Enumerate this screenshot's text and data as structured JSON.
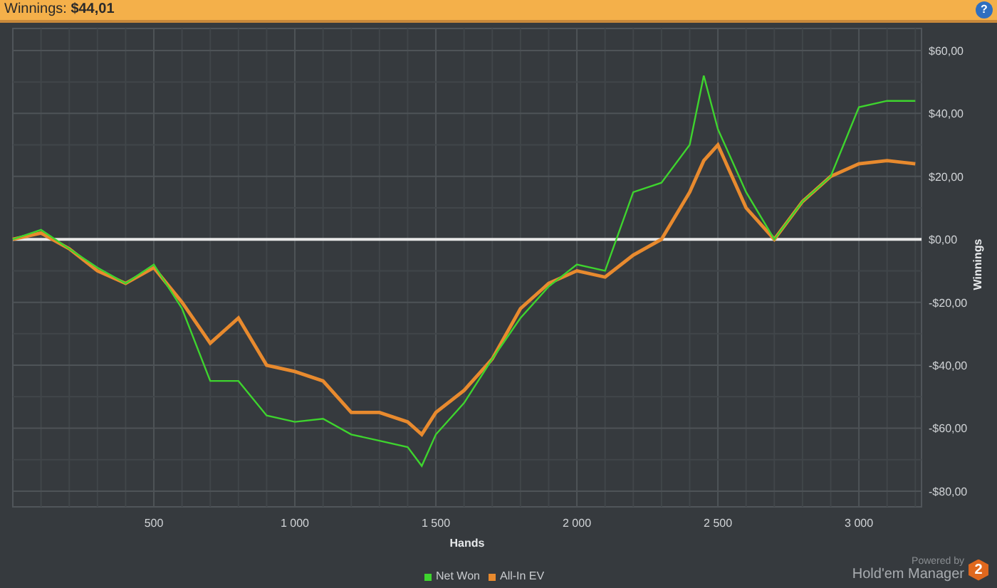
{
  "header": {
    "text": "Winnings: **$44,01**",
    "help": "?"
  },
  "chart": {
    "chart_data": {
      "type": "line",
      "xlabel": "Hands",
      "ylabel": "Winnings",
      "x": [
        0,
        100,
        200,
        300,
        400,
        500,
        600,
        700,
        800,
        900,
        1000,
        1100,
        1200,
        1300,
        1400,
        1450,
        1500,
        1600,
        1700,
        1800,
        1900,
        2000,
        2100,
        2200,
        2300,
        2400,
        2450,
        2500,
        2600,
        2700,
        2800,
        2900,
        3000,
        3100,
        3200
      ],
      "series": [
        {
          "name": "Net Won",
          "color": "#3ed42e",
          "values": [
            0,
            3,
            -3,
            -9,
            -14,
            -8,
            -22,
            -45,
            -45,
            -56,
            -58,
            -57,
            -62,
            -64,
            -66,
            -72,
            -62,
            -52,
            -38,
            -25,
            -15,
            -8,
            -10,
            15,
            18,
            30,
            52,
            35,
            15,
            0,
            12,
            20,
            42,
            44,
            44
          ]
        },
        {
          "name": "All-In EV",
          "color": "#e88a2e",
          "values": [
            0,
            2,
            -3,
            -10,
            -14,
            -9,
            -20,
            -33,
            -25,
            -40,
            -42,
            -45,
            -55,
            -55,
            -58,
            -62,
            -55,
            -48,
            -38,
            -22,
            -14,
            -10,
            -12,
            -5,
            0,
            15,
            25,
            30,
            10,
            0,
            12,
            20,
            24,
            25,
            24
          ]
        }
      ],
      "grid": true,
      "xlim": [
        0,
        3222
      ],
      "ylim": [
        -85,
        67
      ],
      "xticks": [
        {
          "value": 500,
          "label": "500"
        },
        {
          "value": 1000,
          "label": "1 000"
        },
        {
          "value": 1500,
          "label": "1 500"
        },
        {
          "value": 2000,
          "label": "2 000"
        },
        {
          "value": 2500,
          "label": "2 500"
        },
        {
          "value": 3000,
          "label": "3 000"
        }
      ],
      "yticks": [
        {
          "value": 60,
          "label": "$60,00"
        },
        {
          "value": 40,
          "label": "$40,00"
        },
        {
          "value": 20,
          "label": "$20,00"
        },
        {
          "value": 0,
          "label": "$0,00"
        },
        {
          "value": -20,
          "label": "-$20,00"
        },
        {
          "value": -40,
          "label": "-$40,00"
        },
        {
          "value": -60,
          "label": "-$60,00"
        },
        {
          "value": -80,
          "label": "-$80,00"
        }
      ]
    }
  },
  "branding": {
    "powered": "Powered by",
    "product": "Hold'em Manager",
    "badge": "2"
  }
}
